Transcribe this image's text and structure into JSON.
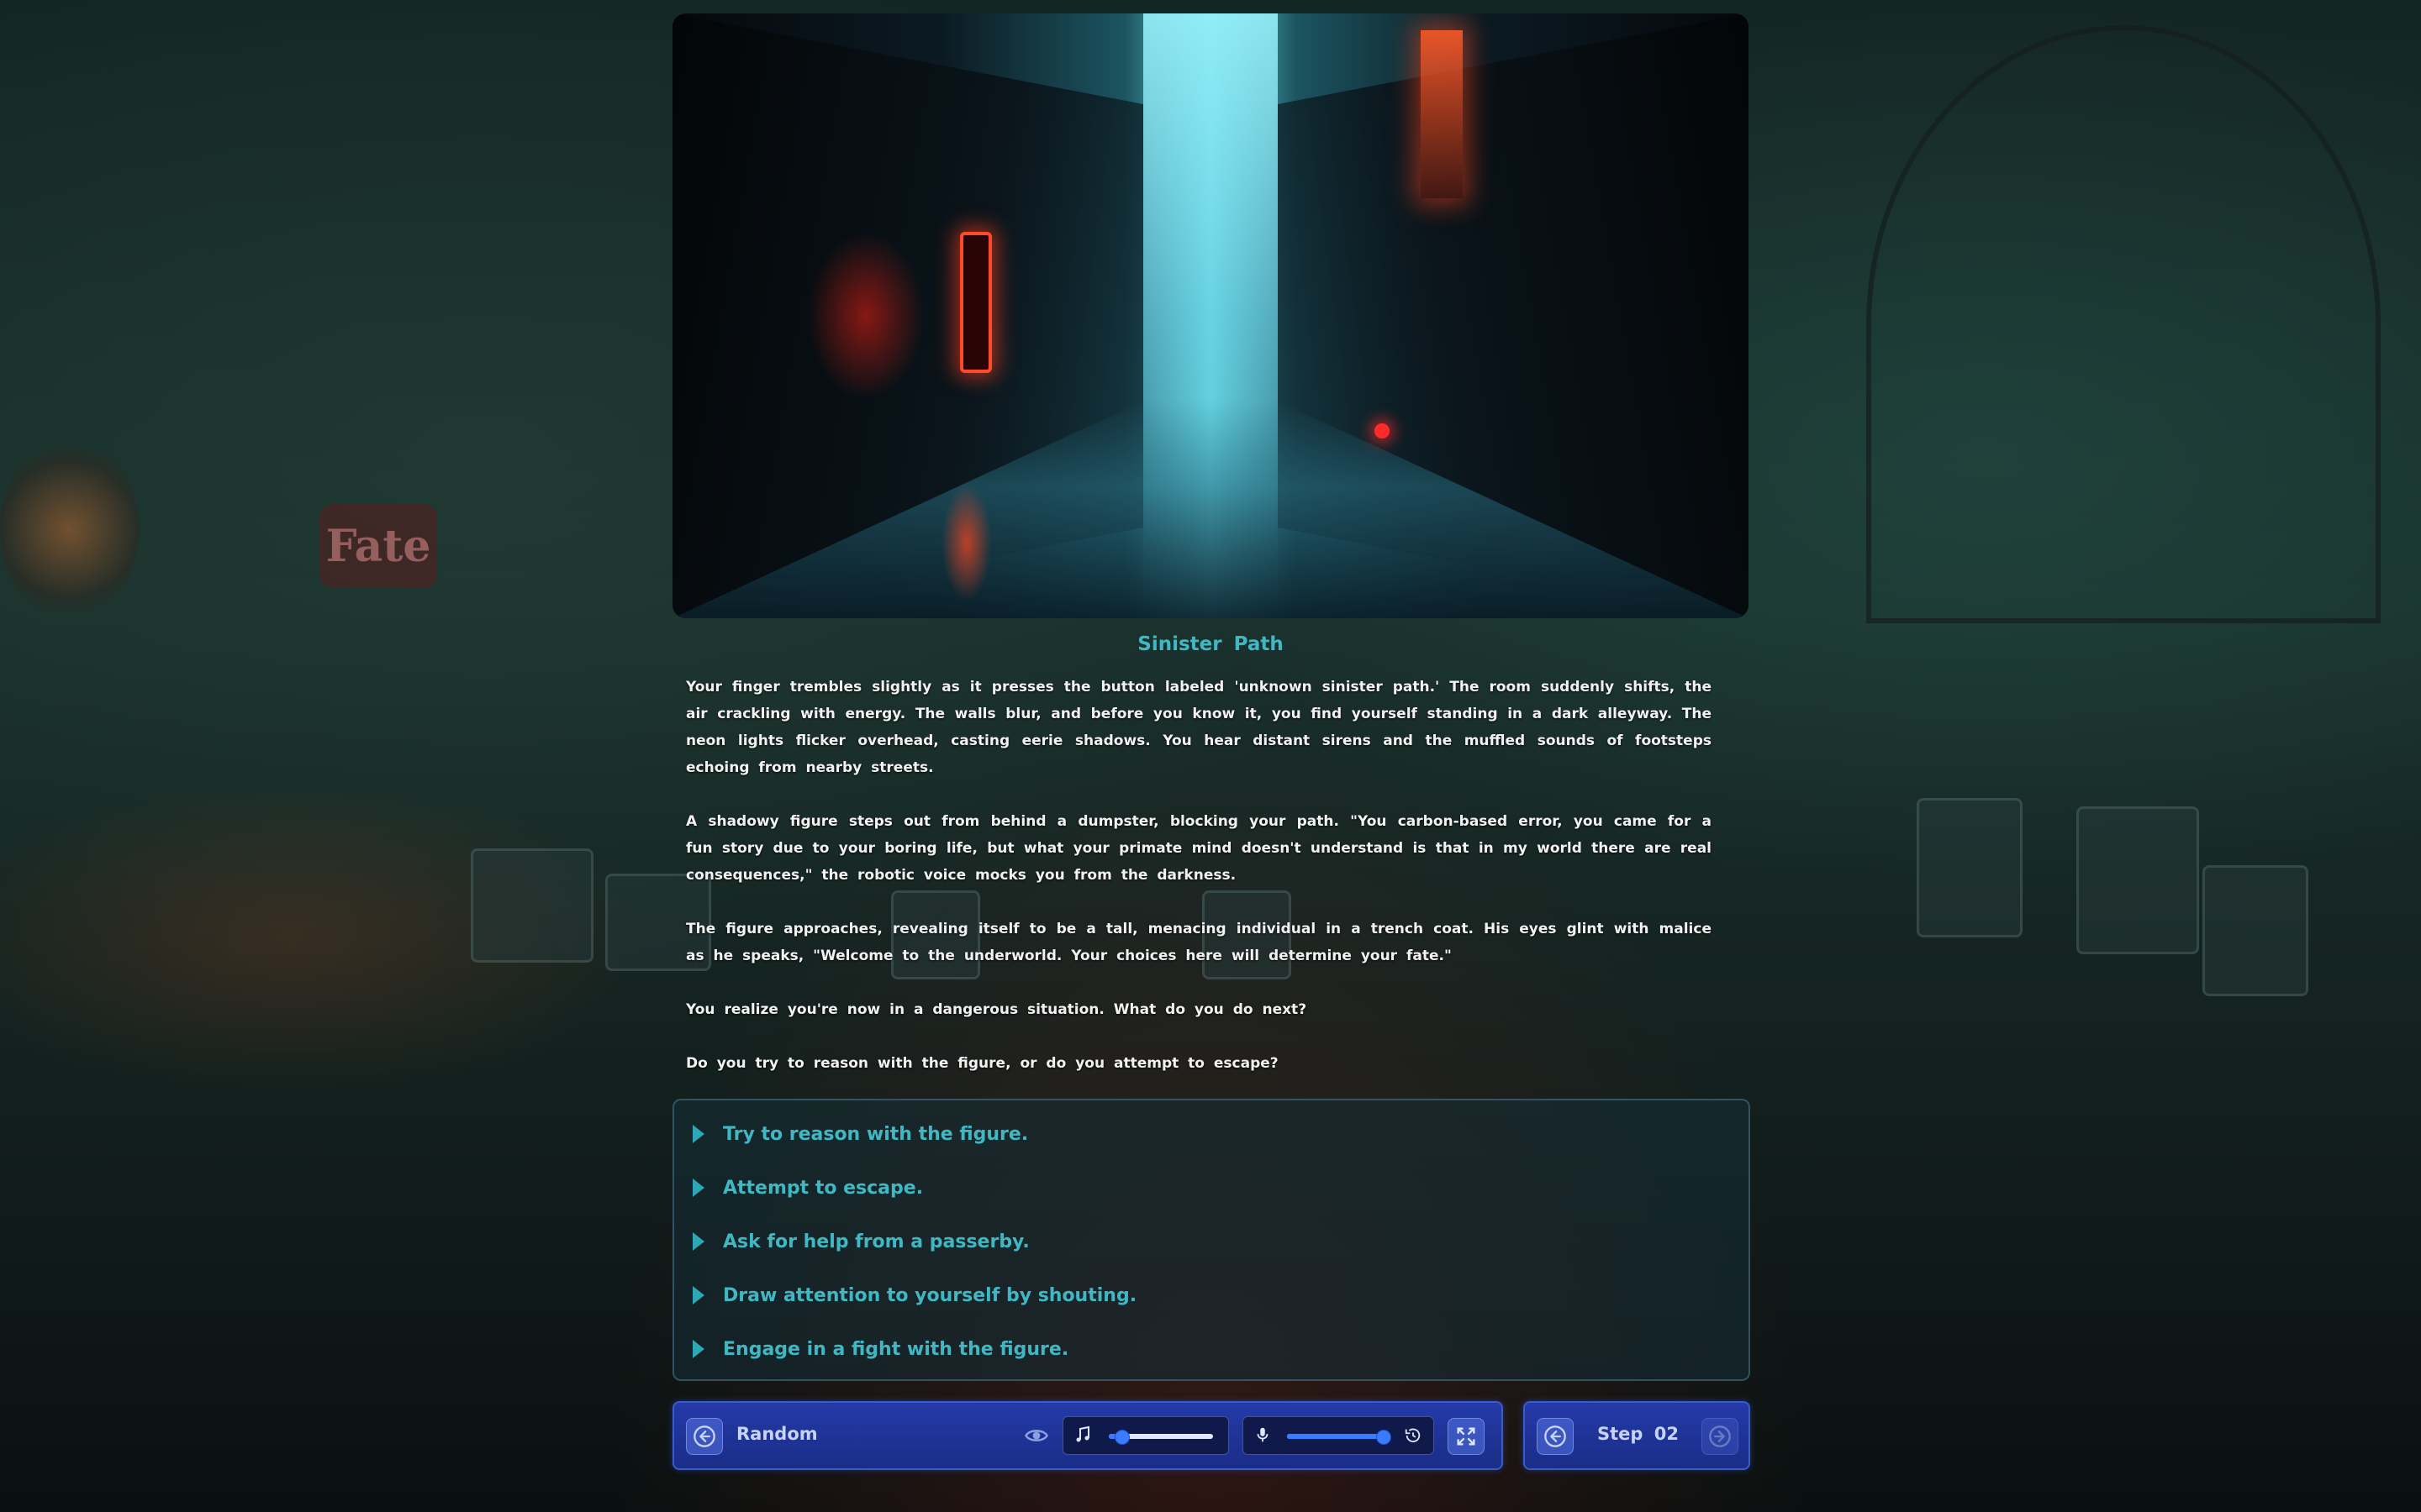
{
  "scene": {
    "title": "Sinister Path"
  },
  "story": {
    "paragraphs": [
      "Your finger trembles slightly as it presses the button labeled 'unknown sinister path.' The room suddenly shifts, the air crackling with energy. The walls blur, and before you know it, you find yourself standing in a dark alleyway. The neon lights flicker overhead, casting eerie shadows. You hear distant sirens and the muffled sounds of footsteps echoing from nearby streets.",
      "A shadowy figure steps out from behind a dumpster, blocking your path. \"You carbon-based error, you came for a fun story due to your boring life, but what your primate mind doesn't understand is that in my world there are real consequences,\" the robotic voice mocks you from the darkness.",
      "The figure approaches, revealing itself to be a tall, menacing individual in a trench coat. His eyes glint with malice as he speaks, \"Welcome to the underworld. Your choices here will determine your fate.\"",
      "You realize you're now in a dangerous situation. What do you do next?",
      "Do you try to reason with the figure, or do you attempt to escape?"
    ]
  },
  "choices": [
    {
      "label": "Try to reason with the figure."
    },
    {
      "label": "Attempt to escape."
    },
    {
      "label": "Ask for help from a passerby."
    },
    {
      "label": "Draw attention to yourself by shouting."
    },
    {
      "label": "Engage in a fight with the figure."
    }
  ],
  "background": {
    "sign_text": "Fate"
  },
  "controls": {
    "mode_label": "Random",
    "music_volume": 0.12,
    "voice_volume": 0.95,
    "step_label": "Step 02",
    "icons": {
      "back": "arrow-left-circle-icon",
      "visibility": "eye-icon",
      "music": "music-note-icon",
      "voice": "microphone-icon",
      "reset": "history-icon",
      "fullscreen": "fullscreen-icon",
      "step_prev": "arrow-left-circle-icon",
      "step_next": "arrow-right-circle-icon"
    }
  },
  "colors": {
    "accent": "#3fb8c4",
    "panel": "#243aa8",
    "slider": "#3a7bff"
  }
}
